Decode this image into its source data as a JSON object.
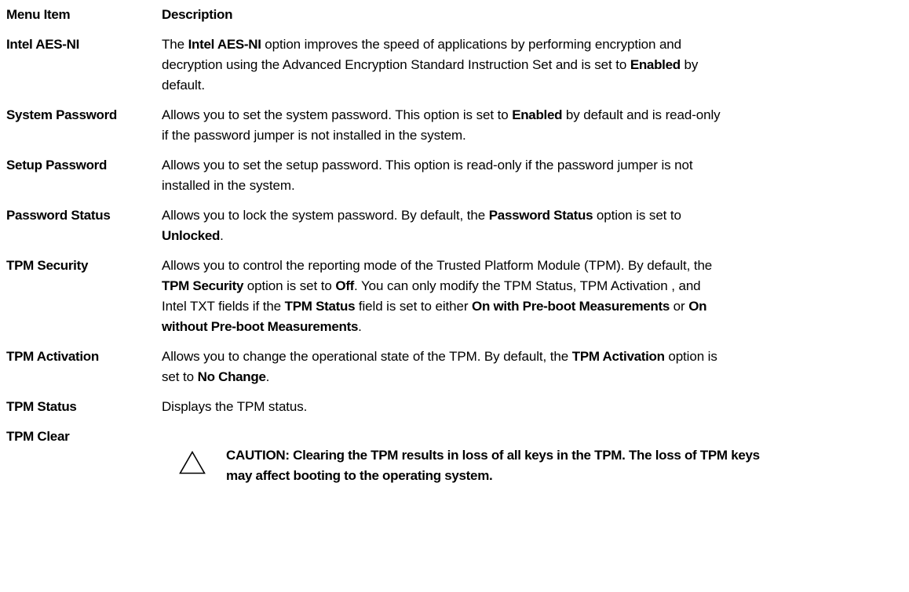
{
  "header": {
    "menu_item": "Menu Item",
    "description": "Description"
  },
  "rows": [
    {
      "term": "Intel AES-NI",
      "parts": [
        {
          "t": "The ",
          "b": false
        },
        {
          "t": "Intel AES-NI",
          "b": true
        },
        {
          "t": " option improves the speed of applications by performing encryption and",
          "b": false
        },
        {
          "br": true
        },
        {
          "t": "decryption using the Advanced Encryption Standard Instruction Set and is set to ",
          "b": false
        },
        {
          "t": "Enabled",
          "b": true
        },
        {
          "t": " by",
          "b": false
        },
        {
          "br": true
        },
        {
          "t": "default.",
          "b": false
        }
      ]
    },
    {
      "term": "System Password",
      "parts": [
        {
          "t": "Allows you to set the system password. This option is set to ",
          "b": false
        },
        {
          "t": "Enabled",
          "b": true
        },
        {
          "t": " by default and is read-only",
          "b": false
        },
        {
          "br": true
        },
        {
          "t": "if the password jumper is not installed in the system.",
          "b": false
        }
      ]
    },
    {
      "term": "Setup Password",
      "parts": [
        {
          "t": "Allows you to set the setup password. This option is read-only if the password jumper is not",
          "b": false
        },
        {
          "br": true
        },
        {
          "t": "installed in the system.",
          "b": false
        }
      ]
    },
    {
      "term": "Password Status",
      "parts": [
        {
          "t": "Allows you to lock the system password. By default, the ",
          "b": false
        },
        {
          "t": "Password Status",
          "b": true
        },
        {
          "t": " option is set to",
          "b": false
        },
        {
          "br": true
        },
        {
          "t": "Unlocked",
          "b": true
        },
        {
          "t": ".",
          "b": false
        }
      ]
    },
    {
      "term": "TPM Security",
      "parts": [
        {
          "t": "Allows you to control the reporting mode of the Trusted Platform Module (TPM). By default, the",
          "b": false
        },
        {
          "br": true
        },
        {
          "t": "TPM Security",
          "b": true
        },
        {
          "t": " option is set to ",
          "b": false
        },
        {
          "t": "Off",
          "b": true
        },
        {
          "t": ". You can only modify the TPM Status, TPM Activation , and",
          "b": false
        },
        {
          "br": true
        },
        {
          "t": "Intel TXT fields if the ",
          "b": false
        },
        {
          "t": "TPM Status",
          "b": true
        },
        {
          "t": " field is set to either ",
          "b": false
        },
        {
          "t": "On with Pre-boot Measurements",
          "b": true
        },
        {
          "t": " or ",
          "b": false
        },
        {
          "t": "On",
          "b": true
        },
        {
          "br": true
        },
        {
          "t": "without Pre-boot Measurements",
          "b": true
        },
        {
          "t": ".",
          "b": false
        }
      ]
    },
    {
      "term": "TPM Activation",
      "parts": [
        {
          "t": "Allows you to change the operational state of the TPM. By default, the ",
          "b": false
        },
        {
          "t": "TPM Activation",
          "b": true
        },
        {
          "t": " option is",
          "b": false
        },
        {
          "br": true
        },
        {
          "t": "set to ",
          "b": false
        },
        {
          "t": "No Change",
          "b": true
        },
        {
          "t": ".",
          "b": false
        }
      ]
    },
    {
      "term": "TPM Status",
      "parts": [
        {
          "t": "Displays the TPM status.",
          "b": false
        }
      ]
    }
  ],
  "tpm_clear": {
    "term": "TPM Clear",
    "icon": "caution-triangle-icon",
    "caution_line1": "CAUTION: Clearing the TPM results in loss of all keys in the TPM. The loss of TPM keys",
    "caution_line2": "may affect booting to the operating system."
  }
}
